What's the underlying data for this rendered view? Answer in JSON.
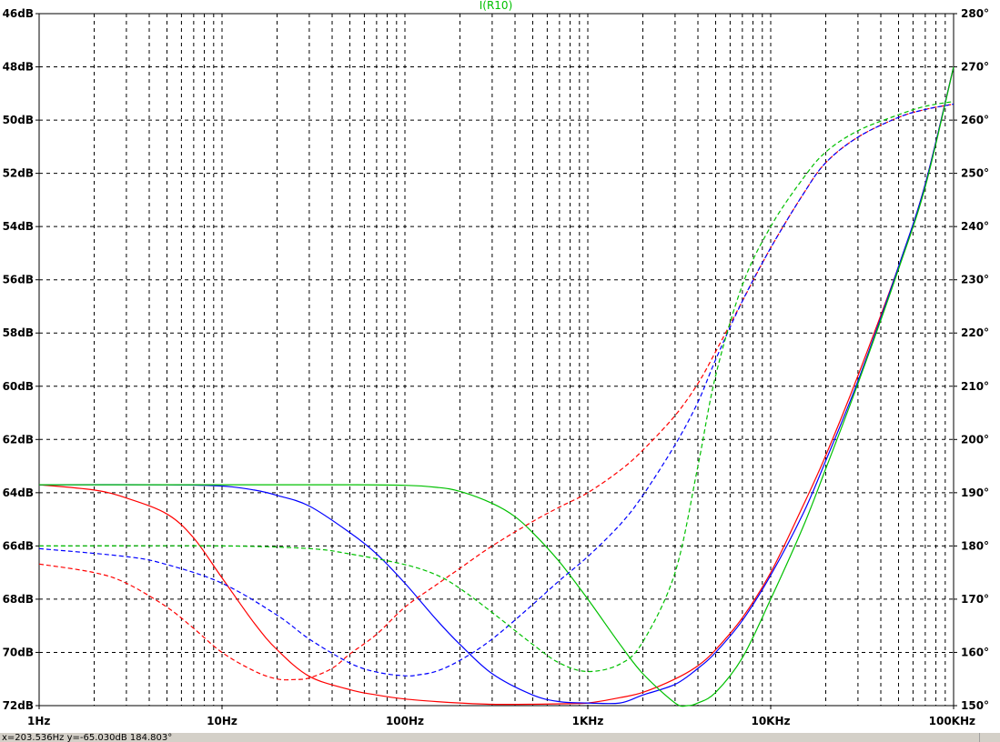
{
  "status_text": "x=203.536Hz   y=-65.030dB  184.803°",
  "chart_data": {
    "type": "line",
    "title": "I(R10)",
    "x_scale": "log",
    "xlim": [
      1,
      100000
    ],
    "x_ticks": [
      {
        "value": 1,
        "label": "1Hz"
      },
      {
        "value": 10,
        "label": "10Hz"
      },
      {
        "value": 100,
        "label": "100Hz"
      },
      {
        "value": 1000,
        "label": "1KHz"
      },
      {
        "value": 10000,
        "label": "10KHz"
      },
      {
        "value": 100000,
        "label": "100KHz"
      }
    ],
    "ylim_left": [
      -72,
      -46
    ],
    "y_left_ticks": [
      "46dB",
      "48dB",
      "50dB",
      "52dB",
      "54dB",
      "56dB",
      "58dB",
      "60dB",
      "62dB",
      "64dB",
      "66dB",
      "68dB",
      "70dB",
      "72dB"
    ],
    "ylim_right": [
      150,
      280
    ],
    "y_right_ticks": [
      "280°",
      "270°",
      "260°",
      "250°",
      "240°",
      "230°",
      "220°",
      "210°",
      "200°",
      "190°",
      "180°",
      "170°",
      "160°",
      "150°"
    ],
    "grid": true,
    "series": [
      {
        "color": "#ff0000",
        "style": "solid",
        "axis": "magnitude",
        "x": [
          1,
          2,
          3,
          5,
          7,
          10,
          15,
          20,
          30,
          50,
          70,
          100,
          150,
          200,
          300,
          500,
          700,
          1000,
          1500,
          2000,
          3000,
          4000,
          5000,
          7000,
          10000,
          15000,
          20000,
          30000,
          50000,
          70000,
          100000
        ],
        "y": [
          -63.7,
          -63.9,
          -64.2,
          -64.8,
          -65.7,
          -67.2,
          -68.9,
          -69.9,
          -70.9,
          -71.4,
          -71.6,
          -71.75,
          -71.85,
          -71.9,
          -71.95,
          -71.95,
          -71.93,
          -71.9,
          -71.7,
          -71.5,
          -71.0,
          -70.5,
          -69.9,
          -68.7,
          -67.0,
          -64.5,
          -62.6,
          -59.6,
          -55.5,
          -52.4,
          -48.0
        ]
      },
      {
        "color": "#0000ff",
        "style": "solid",
        "axis": "magnitude",
        "x": [
          1,
          5,
          10,
          15,
          20,
          30,
          50,
          70,
          100,
          150,
          200,
          300,
          500,
          700,
          1000,
          1500,
          2000,
          3000,
          4000,
          5000,
          7000,
          10000,
          15000,
          20000,
          30000,
          50000,
          70000,
          100000
        ],
        "y": [
          -63.7,
          -63.7,
          -63.75,
          -63.9,
          -64.1,
          -64.5,
          -65.5,
          -66.3,
          -67.4,
          -68.8,
          -69.7,
          -70.8,
          -71.6,
          -71.85,
          -71.9,
          -71.9,
          -71.6,
          -71.2,
          -70.6,
          -70.0,
          -68.8,
          -67.1,
          -64.8,
          -62.8,
          -59.8,
          -55.5,
          -52.4,
          -48.0
        ]
      },
      {
        "color": "#00c000",
        "style": "solid",
        "axis": "magnitude",
        "x": [
          1,
          10,
          50,
          100,
          150,
          200,
          300,
          400,
          500,
          700,
          1000,
          1500,
          2000,
          3000,
          3500,
          4000,
          5000,
          7000,
          10000,
          15000,
          20000,
          30000,
          50000,
          70000,
          100000
        ],
        "y": [
          -63.7,
          -63.7,
          -63.7,
          -63.72,
          -63.8,
          -63.95,
          -64.4,
          -64.9,
          -65.5,
          -66.6,
          -68.0,
          -69.7,
          -70.8,
          -71.9,
          -72.0,
          -71.9,
          -71.5,
          -70.2,
          -68.0,
          -65.3,
          -63.1,
          -59.9,
          -55.6,
          -52.5,
          -48.0
        ]
      },
      {
        "color": "#ff0000",
        "style": "dashed",
        "axis": "phase",
        "x": [
          1,
          2,
          3,
          5,
          7,
          10,
          15,
          20,
          25,
          30,
          40,
          50,
          70,
          100,
          150,
          200,
          300,
          500,
          700,
          1000,
          1500,
          2000,
          3000,
          4000,
          5000,
          7000,
          10000,
          15000,
          20000,
          30000,
          50000,
          70000,
          100000
        ],
        "y": [
          176.6,
          175.0,
          173.0,
          168.5,
          164.5,
          160.0,
          156.5,
          155.0,
          154.9,
          155.2,
          157.0,
          159.7,
          163.4,
          168.5,
          172.8,
          175.8,
          180.0,
          184.6,
          187.3,
          190.0,
          194.2,
          198.0,
          204.5,
          210.5,
          216.5,
          226.0,
          236.0,
          246.0,
          252.0,
          256.8,
          260.5,
          262.0,
          263.0
        ]
      },
      {
        "color": "#0000ff",
        "style": "dashed",
        "axis": "phase",
        "x": [
          1,
          3,
          5,
          10,
          20,
          30,
          50,
          70,
          100,
          120,
          150,
          200,
          300,
          500,
          700,
          1000,
          1500,
          2000,
          3000,
          4000,
          5000,
          7000,
          10000,
          15000,
          20000,
          30000,
          50000,
          70000,
          100000
        ],
        "y": [
          179.5,
          178.0,
          176.5,
          173.0,
          167.0,
          162.5,
          158.0,
          156.3,
          155.6,
          155.8,
          156.5,
          158.5,
          162.5,
          169.0,
          173.5,
          178.0,
          184.0,
          189.5,
          199.0,
          207.0,
          215.0,
          226.0,
          236.0,
          246.0,
          252.0,
          256.8,
          260.5,
          262.0,
          263.0
        ]
      },
      {
        "color": "#00c000",
        "style": "dashed",
        "axis": "phase",
        "x": [
          1,
          10,
          30,
          50,
          100,
          150,
          200,
          300,
          500,
          700,
          1000,
          1500,
          2000,
          3000,
          4000,
          5000,
          7000,
          10000,
          15000,
          20000,
          30000,
          50000,
          70000,
          100000
        ],
        "y": [
          180.0,
          180.0,
          179.5,
          178.5,
          176.5,
          174.5,
          172.0,
          167.5,
          161.5,
          158.0,
          156.4,
          157.8,
          162.0,
          175.0,
          195.0,
          212.0,
          229.0,
          240.0,
          249.0,
          254.0,
          258.0,
          261.0,
          262.6,
          263.5
        ]
      }
    ]
  }
}
